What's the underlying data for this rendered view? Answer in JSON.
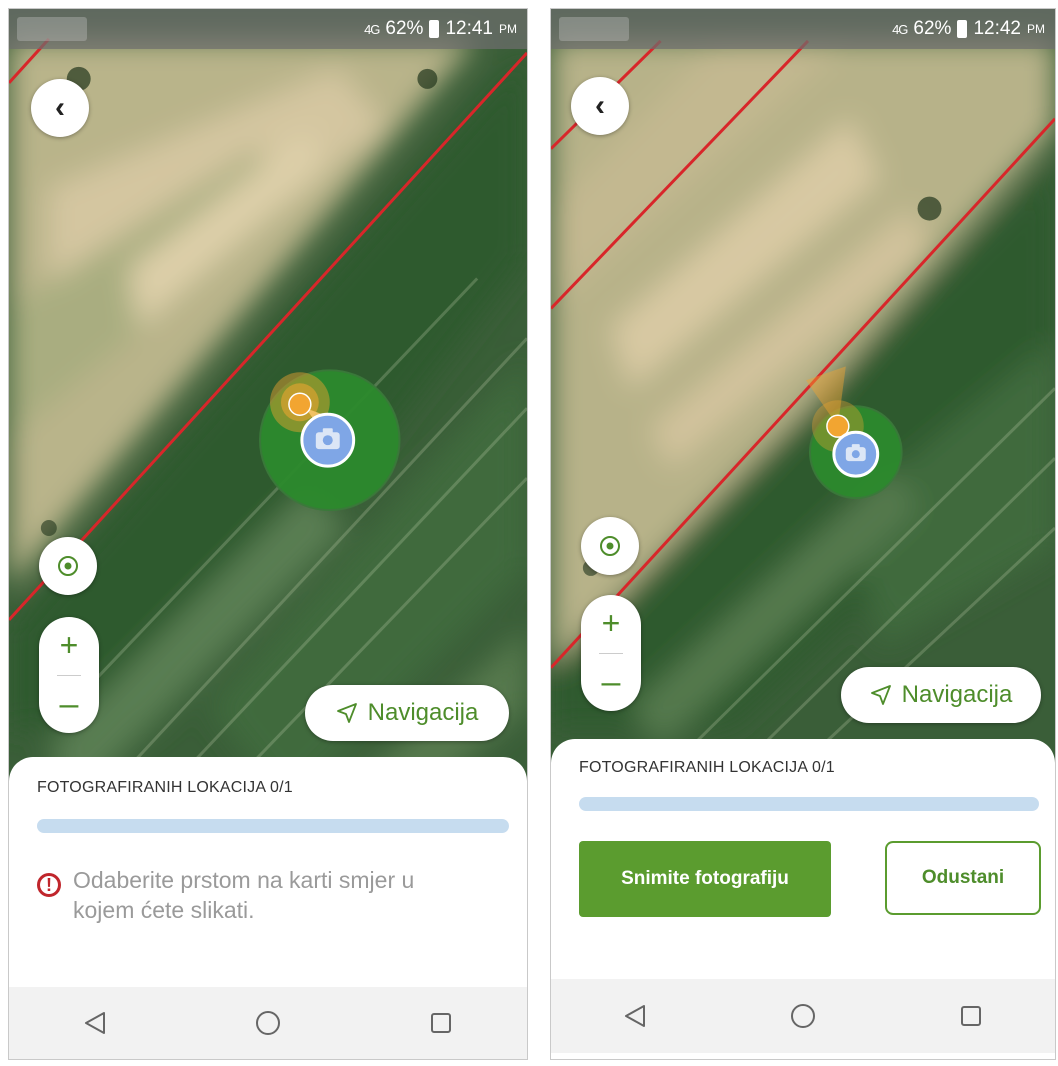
{
  "screens": [
    {
      "status_time": "12:41",
      "status_ampm": "PM",
      "battery": "62%",
      "signal": "4G",
      "navigation_label": "Navigacija",
      "panel_title": "FOTOGRAFIRANIH LOKACIJA 0/1",
      "message": "Odaberite prstom na karti smjer u kojem ćete slikati."
    },
    {
      "status_time": "12:42",
      "status_ampm": "PM",
      "battery": "62%",
      "signal": "4G",
      "navigation_label": "Navigacija",
      "panel_title": "FOTOGRAFIRANIH LOKACIJA 0/1",
      "primary_button": "Snimite fotografiju",
      "secondary_button": "Odustani"
    }
  ],
  "icons": [
    "back-arrow-icon",
    "locate-icon",
    "zoom-in-icon",
    "zoom-out-icon",
    "navigation-arrow-icon",
    "camera-icon",
    "warning-icon",
    "nav-back-icon",
    "nav-home-icon",
    "nav-recents-icon"
  ],
  "colors": {
    "accent_green": "#5b9c2f",
    "parcel_border": "#d8262a",
    "progress_track": "#c6dcef",
    "warning_red": "#c0262c",
    "camera_marker": "#7fa6e6",
    "heading_marker": "#f2a531"
  }
}
